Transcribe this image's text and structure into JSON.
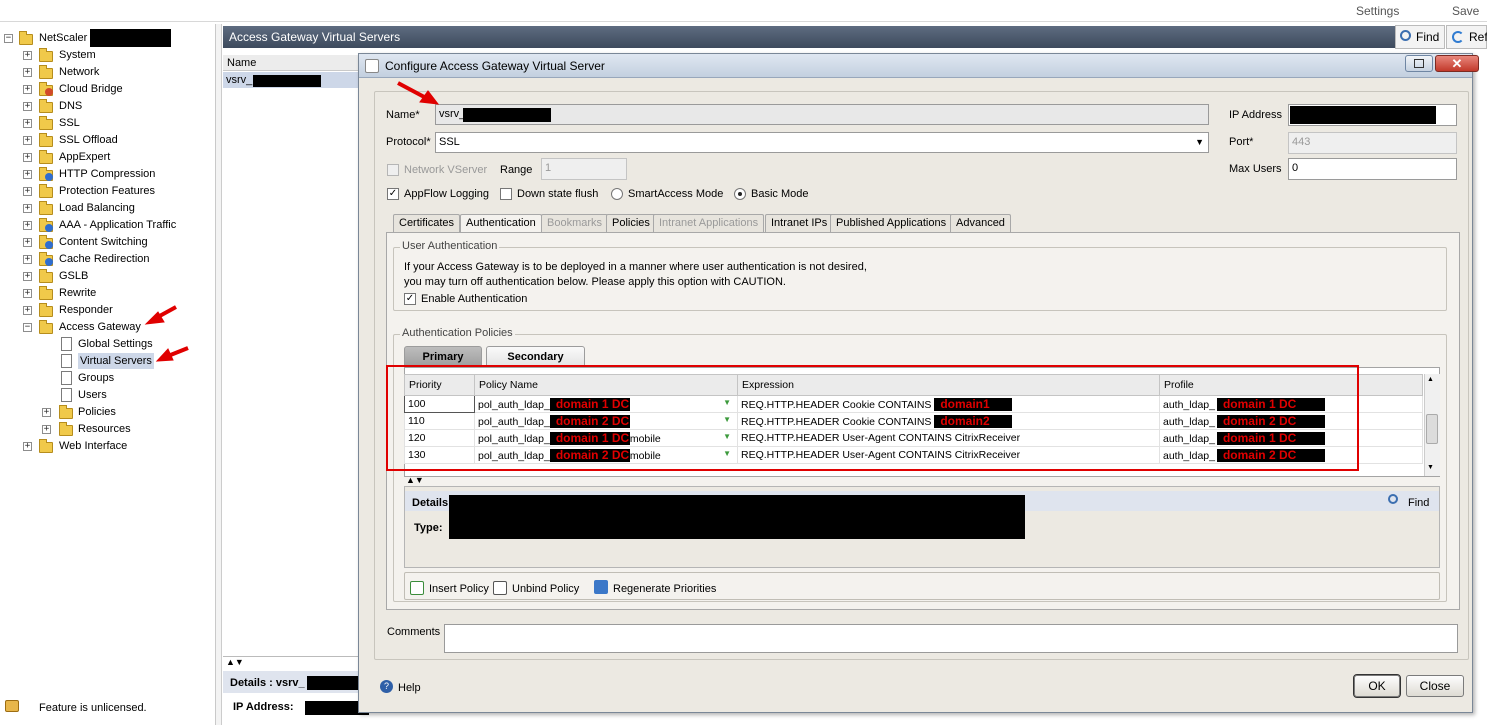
{
  "topbar": {
    "settings": "Settings",
    "save": "Save"
  },
  "tree": {
    "root": "NetScaler",
    "items": [
      "System",
      "Network",
      "Cloud Bridge",
      "DNS",
      "SSL",
      "SSL Offload",
      "AppExpert",
      "HTTP Compression",
      "Protection Features",
      "Load Balancing",
      "AAA - Application Traffic",
      "Content Switching",
      "Cache Redirection",
      "GSLB",
      "Rewrite",
      "Responder",
      "Access Gateway"
    ],
    "children": [
      "Global Settings",
      "Virtual Servers",
      "Groups",
      "Users",
      "Policies",
      "Resources"
    ],
    "last": "Web Interface",
    "status": "Feature is unlicensed."
  },
  "mid": {
    "header": "Access Gateway Virtual Servers",
    "find": "Find",
    "refresh": "Ref",
    "col_name": "Name",
    "row1": "vsrv_",
    "details": "Details : vsrv_",
    "ip": "IP Address:"
  },
  "dialog": {
    "title": "Configure Access Gateway Virtual Server",
    "name_label": "Name*",
    "name_value": "vsrv_",
    "protocol_label": "Protocol*",
    "protocol_value": "SSL",
    "ip_label": "IP Address",
    "port_label": "Port*",
    "port_value": "443",
    "max_users_label": "Max Users",
    "max_users_value": "0",
    "network_vserver": "Network VServer",
    "range_label": "Range",
    "range_value": "1",
    "appflow": "AppFlow Logging",
    "down_state": "Down state flush",
    "smartaccess": "SmartAccess Mode",
    "basic": "Basic Mode",
    "tabs": [
      "Certificates",
      "Authentication",
      "Bookmarks",
      "Policies",
      "Intranet Applications",
      "Intranet IPs",
      "Published Applications",
      "Advanced"
    ],
    "user_auth_title": "User Authentication",
    "user_auth_text1": "If your Access Gateway is to be deployed in a manner where user authentication is not desired,",
    "user_auth_text2": "you may turn off authentication below. Please apply this option with CAUTION.",
    "enable_auth": "Enable Authentication",
    "auth_policies_title": "Authentication Policies",
    "primary": "Primary",
    "secondary": "Secondary",
    "columns": [
      "Priority",
      "Policy Name",
      "Expression",
      "Profile"
    ],
    "rows": [
      {
        "priority": "100",
        "policy": "pol_auth_ldap_",
        "policy_tag": "domain 1 DC",
        "policy_suffix": "",
        "expr": "REQ.HTTP.HEADER Cookie CONTAINS",
        "expr_tag": "domain1",
        "profile": "auth_ldap_",
        "profile_tag": "domain 1 DC"
      },
      {
        "priority": "110",
        "policy": "pol_auth_ldap_",
        "policy_tag": "domain 2 DC",
        "policy_suffix": "",
        "expr": "REQ.HTTP.HEADER Cookie CONTAINS",
        "expr_tag": "domain2",
        "profile": "auth_ldap_",
        "profile_tag": "domain 2 DC"
      },
      {
        "priority": "120",
        "policy": "pol_auth_ldap_",
        "policy_tag": "domain 1 DC",
        "policy_suffix": "mobile",
        "expr": "REQ.HTTP.HEADER User-Agent CONTAINS CitrixReceiver",
        "expr_tag": "",
        "profile": "auth_ldap_",
        "profile_tag": "domain 1 DC"
      },
      {
        "priority": "130",
        "policy": "pol_auth_ldap_",
        "policy_tag": "domain 2 DC",
        "policy_suffix": "mobile",
        "expr": "REQ.HTTP.HEADER User-Agent CONTAINS CitrixReceiver",
        "expr_tag": "",
        "profile": "auth_ldap_",
        "profile_tag": "domain 2 DC"
      }
    ],
    "details_label": "Details",
    "type_label": "Type:",
    "details_find": "Find",
    "insert_policy": "Insert Policy",
    "unbind_policy": "Unbind Policy",
    "regenerate": "Regenerate Priorities",
    "comments_label": "Comments",
    "help": "Help",
    "ok": "OK",
    "close": "Close"
  },
  "colors": {
    "annotation_red": "#e00000",
    "header_bg": "#3d4a5d",
    "dialog_bg": "#ece9e2"
  }
}
